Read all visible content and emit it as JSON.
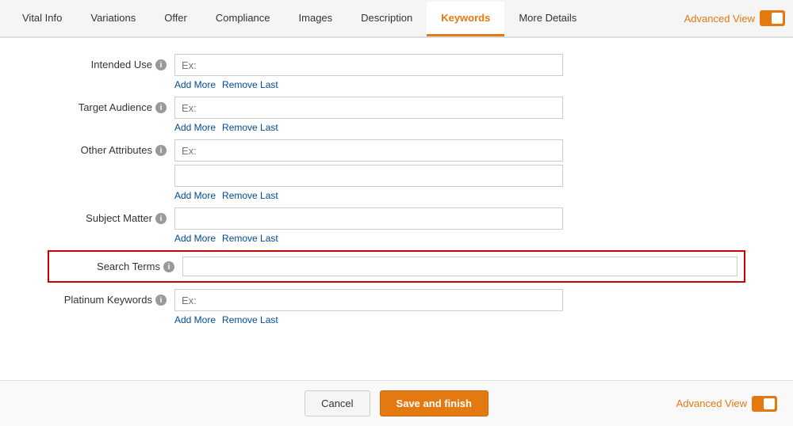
{
  "tabs": [
    {
      "id": "vital-info",
      "label": "Vital Info",
      "active": false
    },
    {
      "id": "variations",
      "label": "Variations",
      "active": false
    },
    {
      "id": "offer",
      "label": "Offer",
      "active": false
    },
    {
      "id": "compliance",
      "label": "Compliance",
      "active": false
    },
    {
      "id": "images",
      "label": "Images",
      "active": false
    },
    {
      "id": "description",
      "label": "Description",
      "active": false
    },
    {
      "id": "keywords",
      "label": "Keywords",
      "active": true
    },
    {
      "id": "more-details",
      "label": "More Details",
      "active": false
    }
  ],
  "advanced_view_label": "Advanced View",
  "fields": {
    "intended_use": {
      "label": "Intended Use",
      "placeholder": "Ex:",
      "add_more": "Add More",
      "remove_last": "Remove Last"
    },
    "target_audience": {
      "label": "Target Audience",
      "placeholder": "Ex:",
      "add_more": "Add More",
      "remove_last": "Remove Last"
    },
    "other_attributes": {
      "label": "Other Attributes",
      "placeholder": "Ex:",
      "add_more": "Add More",
      "remove_last": "Remove Last"
    },
    "subject_matter": {
      "label": "Subject Matter",
      "placeholder": "",
      "add_more": "Add More",
      "remove_last": "Remove Last"
    },
    "search_terms": {
      "label": "Search Terms",
      "placeholder": "",
      "highlighted": true
    },
    "platinum_keywords": {
      "label": "Platinum Keywords",
      "placeholder": "Ex:",
      "add_more": "Add More",
      "remove_last": "Remove Last"
    }
  },
  "footer": {
    "cancel_label": "Cancel",
    "save_label": "Save and finish"
  }
}
